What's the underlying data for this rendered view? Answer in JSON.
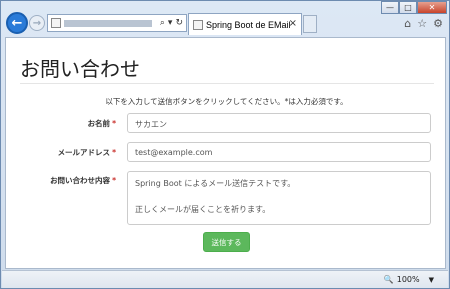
{
  "browser": {
    "back_icon": "←",
    "forward_icon": "→",
    "address_search_icon": "⌕",
    "address_dropdown_icon": "▾",
    "address_refresh_icon": "↻",
    "tab_title": "Spring Boot de EMail",
    "tab_close": "×",
    "window_min": "—",
    "window_max": "□",
    "window_close": "✕",
    "tools": [
      "⌂",
      "☆",
      "⚙"
    ]
  },
  "page": {
    "title": "お問い合わせ",
    "instructions": "以下を入力して送信ボタンをクリックしてください。*は入力必須です。",
    "required_mark": "*",
    "fields": {
      "name_label": "お名前",
      "name_value": "サカエン",
      "email_label": "メールアドレス",
      "email_value": "test@example.com",
      "message_label": "お問い合わせ内容",
      "message_lines": [
        "Spring Boot によるメール送信テストです。",
        "",
        "正しくメールが届くことを祈ります。"
      ]
    },
    "submit_label": "送信する"
  },
  "statusbar": {
    "zoom_icon": "🔍",
    "zoom": "100%",
    "zoom_caret": "▼"
  },
  "colors": {
    "accent": "#2a7bd8",
    "submit": "#5cb85c",
    "required": "#c9302c"
  }
}
